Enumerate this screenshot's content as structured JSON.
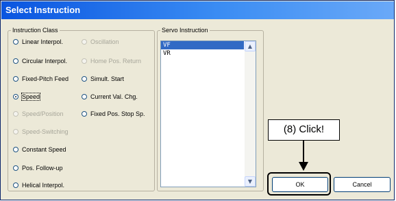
{
  "window": {
    "title": "Select Instruction"
  },
  "instruction_class": {
    "legend": "Instruction Class",
    "options": [
      {
        "label": "Linear Interpol.",
        "enabled": true,
        "checked": false
      },
      {
        "label": "Oscillation",
        "enabled": false,
        "checked": false
      },
      {
        "label": "Circular Interpol.",
        "enabled": true,
        "checked": false
      },
      {
        "label": "Home Pos. Return",
        "enabled": false,
        "checked": false
      },
      {
        "label": "Fixed-Pitch Feed",
        "enabled": true,
        "checked": false
      },
      {
        "label": "Simult. Start",
        "enabled": true,
        "checked": false
      },
      {
        "label": "Speed",
        "enabled": true,
        "checked": true
      },
      {
        "label": "Current Val. Chg.",
        "enabled": true,
        "checked": false
      },
      {
        "label": "Speed/Position",
        "enabled": false,
        "checked": false
      },
      {
        "label": "Fixed Pos. Stop Sp.",
        "enabled": true,
        "checked": false
      },
      {
        "label": "Speed-Switching",
        "enabled": false,
        "checked": false
      },
      {
        "label": "Constant Speed",
        "enabled": true,
        "checked": false
      },
      {
        "label": "Pos. Follow-up",
        "enabled": true,
        "checked": false
      },
      {
        "label": "Helical Interpol.",
        "enabled": true,
        "checked": false
      }
    ]
  },
  "servo_instruction": {
    "legend": "Servo Instruction",
    "items": [
      {
        "label": "VF",
        "selected": true
      },
      {
        "label": "VR",
        "selected": false
      }
    ]
  },
  "buttons": {
    "ok": "OK",
    "cancel": "Cancel"
  },
  "annotation": {
    "callout": "(8) Click!"
  },
  "icons": {
    "scroll_up": "scroll-up-arrow-icon",
    "scroll_down": "scroll-down-arrow-icon",
    "pointer": "down-arrow-icon"
  }
}
